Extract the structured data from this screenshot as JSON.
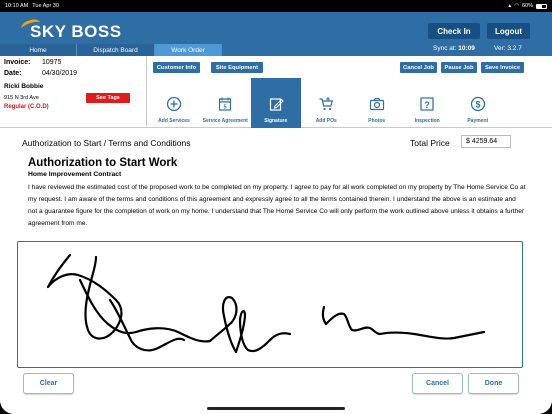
{
  "statusbar": {
    "time": "10:10 AM",
    "date": "Tue Apr 30",
    "battery": "60%"
  },
  "header": {
    "logo": "SKY BOSS",
    "check_in": "Check In",
    "logout": "Logout",
    "sync_label": "Sync at:",
    "sync_time": "10:09",
    "version": "Ver: 3.2.7",
    "tabs": [
      {
        "label": "Home"
      },
      {
        "label": "Dispatch Board"
      },
      {
        "label": "Work Order"
      }
    ]
  },
  "customer": {
    "invoice_label": "Invoice:",
    "invoice": "10975",
    "date_label": "Date:",
    "date": "04/30/2019",
    "name": "Ricki Bobbie",
    "address": "915 N 3rd Ave",
    "terms": "Regular (C.O.D)",
    "see_tags": "See Tags"
  },
  "actions": {
    "customer_info": "Customer Info",
    "site_equipment": "Site Equipment",
    "cancel_job": "Cancel Job",
    "pause_job": "Pause Job",
    "save_invoice": "Save Invoice"
  },
  "toolbar": [
    {
      "label": "Add Services",
      "icon": "plus-circle-icon"
    },
    {
      "label": "Service Agreement",
      "icon": "calendar-icon"
    },
    {
      "label": "Signature",
      "icon": "pen-edit-icon"
    },
    {
      "label": "Add POs",
      "icon": "cart-icon"
    },
    {
      "label": "Photos",
      "icon": "camera-icon"
    },
    {
      "label": "Inspection",
      "icon": "question-icon"
    },
    {
      "label": "Payment",
      "icon": "dollar-icon"
    }
  ],
  "main": {
    "heading": "Authorization to Start / Terms and Conditions",
    "total_price_label": "Total Price",
    "total_price": "$ 4259.64",
    "doc_title": "Authorization to Start Work",
    "doc_subtitle": "Home Improvement Contract",
    "doc_body": "I have reviewed the estimated cost of the proposed work to be completed on my property. I agree to pay for all work completed on my property by The Home Service Co at my request. I am aware of the terms and conditions of this agreement and expressly agree to all the terms contained therein. I understand the above is an estimate and not a guarantee figure for the completion of work on my home. I understand that  The Home Service Co will only perform the work outlined above unless it obtains a further agreement from me."
  },
  "buttons": {
    "clear": "Clear",
    "cancel": "Cancel",
    "done": "Done"
  },
  "colors": {
    "brand_blue": "#2f6ea4",
    "dark_blue": "#184f82",
    "accent_orange": "#f2a30f",
    "alert_red": "#e01b1b"
  }
}
